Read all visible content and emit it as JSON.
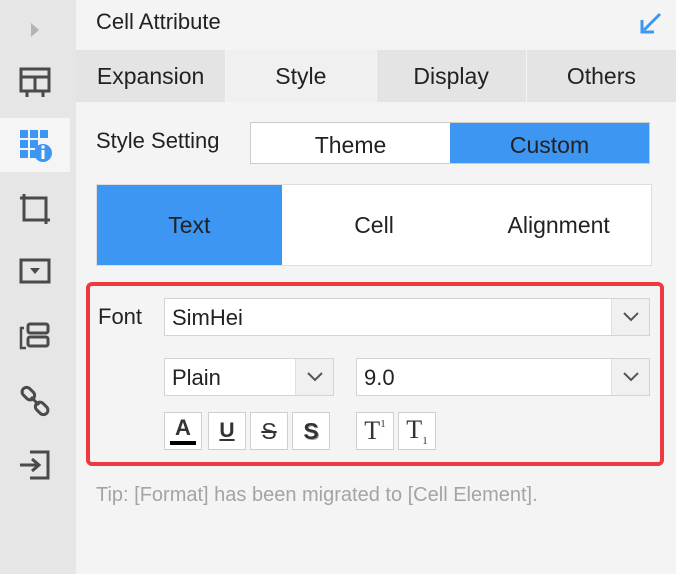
{
  "sidebar": {
    "items": [
      {
        "icon": "expand-arrow-icon"
      },
      {
        "icon": "cell-element-icon"
      },
      {
        "icon": "cell-attribute-icon",
        "active": true
      },
      {
        "icon": "float-element-icon"
      },
      {
        "icon": "widget-settings-icon"
      },
      {
        "icon": "condition-attribute-icon"
      },
      {
        "icon": "hyperlink-icon"
      },
      {
        "icon": "import-icon"
      }
    ]
  },
  "header": {
    "title": "Cell Attribute",
    "collapse_icon": "collapse-arrow-icon"
  },
  "tabs": [
    {
      "label": "Expansion",
      "active": false
    },
    {
      "label": "Style",
      "active": true
    },
    {
      "label": "Display",
      "active": false
    },
    {
      "label": "Others",
      "active": false
    }
  ],
  "style_setting": {
    "label": "Style Setting",
    "options": [
      "Theme",
      "Custom"
    ],
    "selected": "Custom"
  },
  "subtabs": [
    {
      "label": "Text",
      "active": true
    },
    {
      "label": "Cell",
      "active": false
    },
    {
      "label": "Alignment",
      "active": false
    }
  ],
  "font": {
    "label": "Font",
    "family": "SimHei",
    "style": "Plain",
    "size": "9.0",
    "buttons": {
      "color": "A",
      "underline": "U",
      "strikethrough": "S",
      "shadow": "S",
      "superscript_main": "T",
      "superscript_mark": "1",
      "subscript_main": "T",
      "subscript_mark": "1"
    }
  },
  "tip": "Tip: [Format] has been migrated to [Cell Element].",
  "colors": {
    "accent": "#3d96f2",
    "highlight_border": "#ee3a3f",
    "sidebar_icon": "#4a4a4a"
  }
}
